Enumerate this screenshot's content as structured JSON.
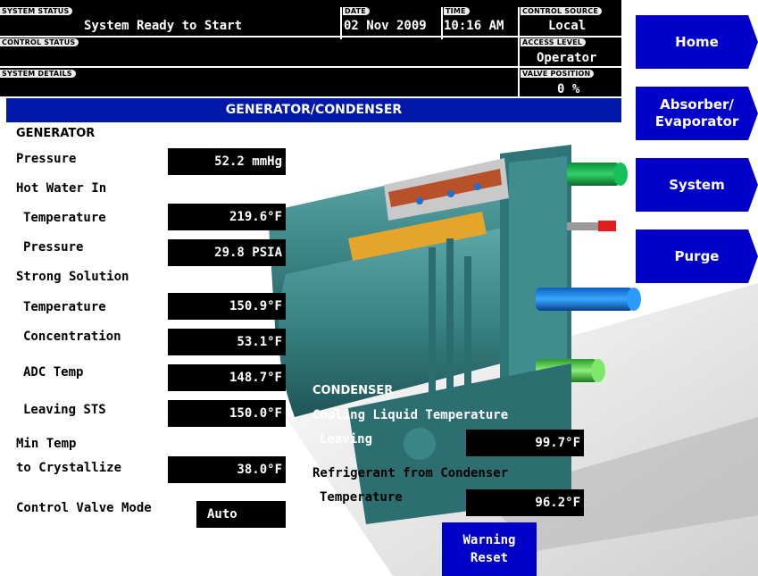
{
  "status_bar": {
    "system_status_label": "SYSTEM STATUS",
    "system_status_value": "System Ready to Start",
    "date_label": "DATE",
    "date_value": "02 Nov 2009",
    "time_label": "TIME",
    "time_value": "10:16 AM",
    "control_source_label": "CONTROL SOURCE",
    "control_source_value": "Local",
    "control_status_label": "CONTROL STATUS",
    "control_status_value": "",
    "access_level_label": "ACCESS LEVEL",
    "access_level_value": "Operator",
    "system_details_label": "SYSTEM DETAILS",
    "system_details_value": "",
    "valve_position_label": "VALVE POSITION",
    "valve_position_value": "0 %"
  },
  "page_title": "GENERATOR/CONDENSER",
  "nav": {
    "home": "Home",
    "absorber_line1": "Absorber/",
    "absorber_line2": "Evaporator",
    "system": "System",
    "purge": "Purge"
  },
  "generator": {
    "heading": "GENERATOR",
    "pressure_label": "Pressure",
    "pressure_value": "52.2 mmHg",
    "hot_water_in_label": "Hot Water In",
    "hw_temp_label": "Temperature",
    "hw_temp_value": "219.6°F",
    "hw_pressure_label": "Pressure",
    "hw_pressure_value": "29.8 PSIA",
    "strong_solution_label": "Strong Solution",
    "ss_temp_label": "Temperature",
    "ss_temp_value": "150.9°F",
    "ss_conc_label": "Concentration",
    "ss_conc_value": "53.1°F",
    "adc_temp_label": "ADC Temp",
    "adc_temp_value": "148.7°F",
    "leaving_sts_label": "Leaving STS",
    "leaving_sts_value": "150.0°F",
    "min_temp_label_1": "Min Temp",
    "min_temp_label_2": "to Crystallize",
    "min_temp_value": "38.0°F",
    "control_valve_mode_label": "Control Valve Mode",
    "control_valve_mode_value": "Auto"
  },
  "condenser": {
    "heading": "CONDENSER",
    "cooling_liquid_label": "Cooling Liquid Temperature",
    "leaving_label": "Leaving",
    "leaving_value": "99.7°F",
    "refrigerant_label": "Refrigerant from Condenser",
    "ref_temp_label": "Temperature",
    "ref_temp_value": "96.2°F"
  },
  "warning_reset": {
    "line1": "Warning",
    "line2": "Reset"
  },
  "colors": {
    "nav_blue": "#0000c8",
    "title_bar_blue": "#0018a8",
    "machine_teal": "#3f8a8c"
  }
}
